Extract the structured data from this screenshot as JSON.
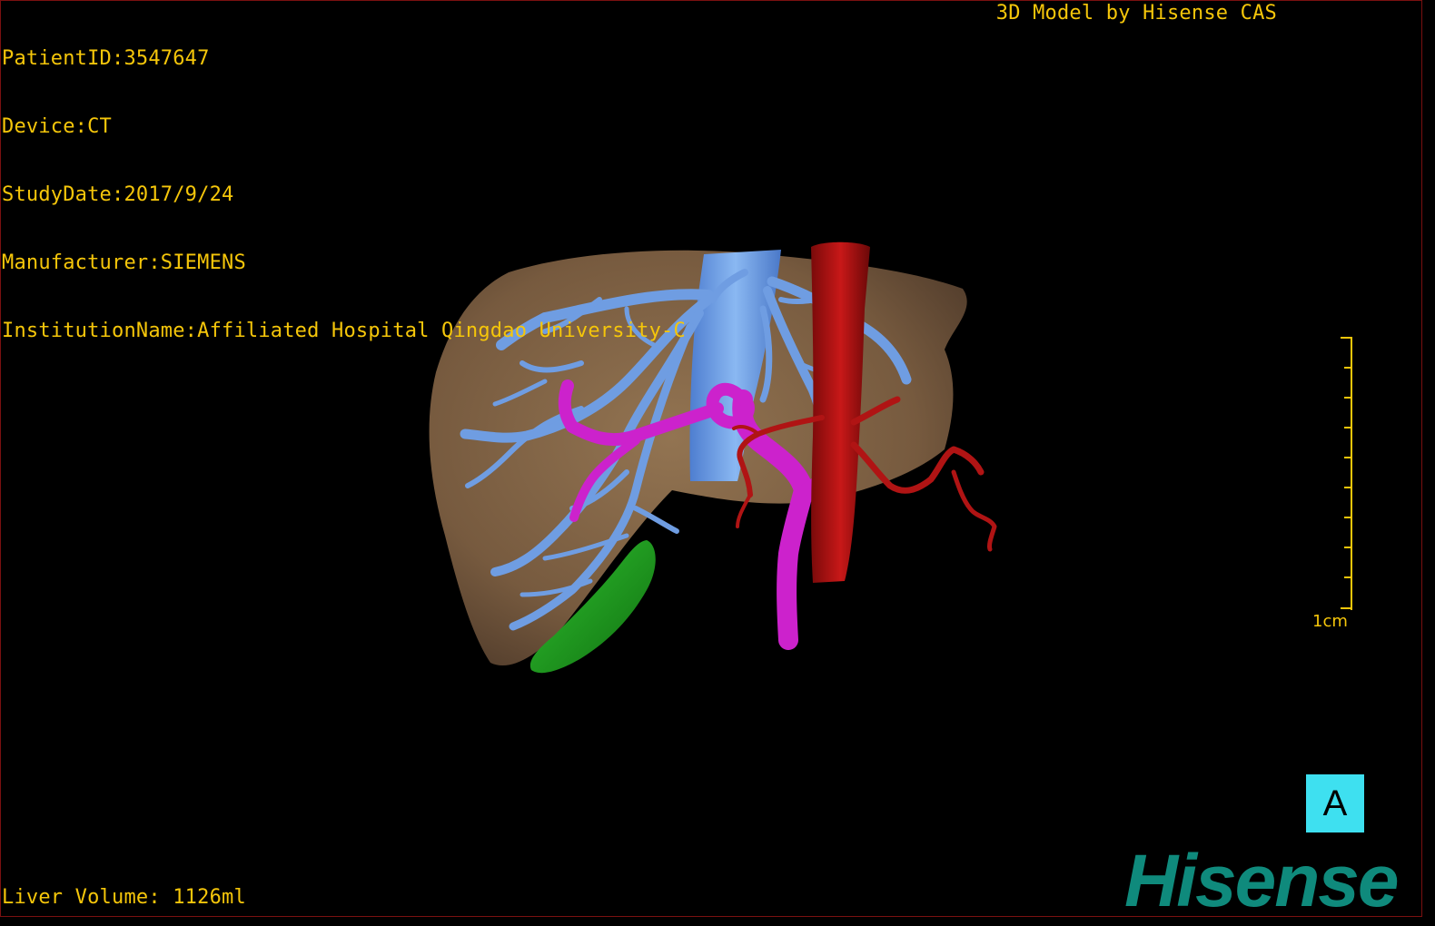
{
  "header": {
    "patient_id": "PatientID:3547647",
    "device": "Device:CT",
    "study_date": "StudyDate:2017/9/24",
    "manufacturer": "Manufacturer:SIEMENS",
    "institution": "InstitutionName:Affiliated Hospital Qingdao University-C",
    "model_credit": "3D Model by Hisense CAS"
  },
  "footer": {
    "liver_volume": "Liver Volume: 1126ml"
  },
  "scale_bar": {
    "label": "1cm"
  },
  "orientation": {
    "label": "A"
  },
  "brand": {
    "label": "Hisense"
  },
  "colors": {
    "overlay_text": "#f5c60a",
    "liver": "#8a6a4a",
    "hepatic_veins": "#6a9ae0",
    "portal_vein": "#d020d0",
    "artery": "#b01010",
    "gallbladder": "#20a020",
    "orientation_bg": "#3ee0f0",
    "brand": "#0f8a7c"
  },
  "icons": {
    "orientation_marker": "orientation-cube-icon"
  }
}
